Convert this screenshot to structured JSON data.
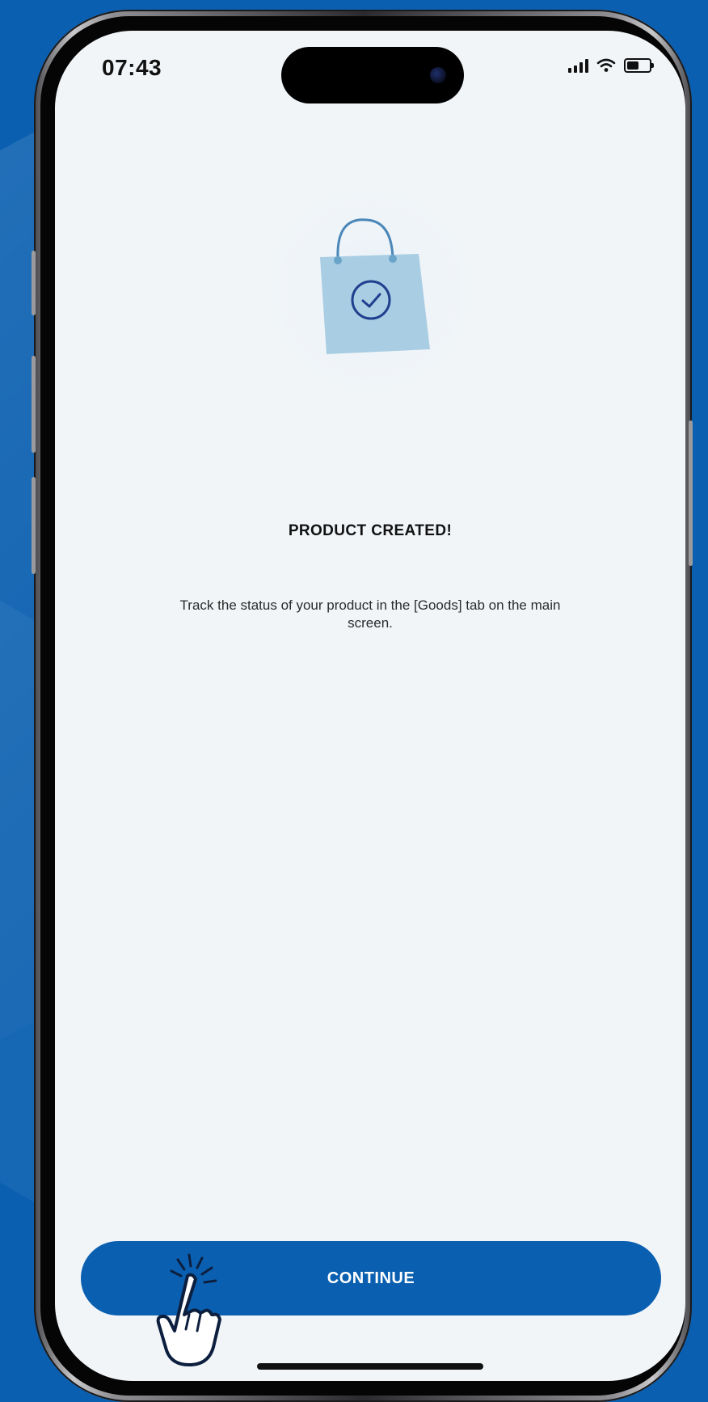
{
  "status_bar": {
    "time": "07:43",
    "icons": [
      "signal-icon",
      "wifi-icon",
      "battery-icon"
    ]
  },
  "illustration": {
    "icon": "shopping-bag-check-icon",
    "bag_color": "#a9cde3",
    "check_color": "#1f3f8f"
  },
  "message": {
    "title": "PRODUCT CREATED!",
    "description": "Track the status of your product in the [Goods] tab on the main screen."
  },
  "actions": {
    "continue_label": "CONTINUE"
  },
  "colors": {
    "background": "#0a5fb0",
    "screen": "#f1f5f8",
    "button": "#0a5fb0"
  }
}
